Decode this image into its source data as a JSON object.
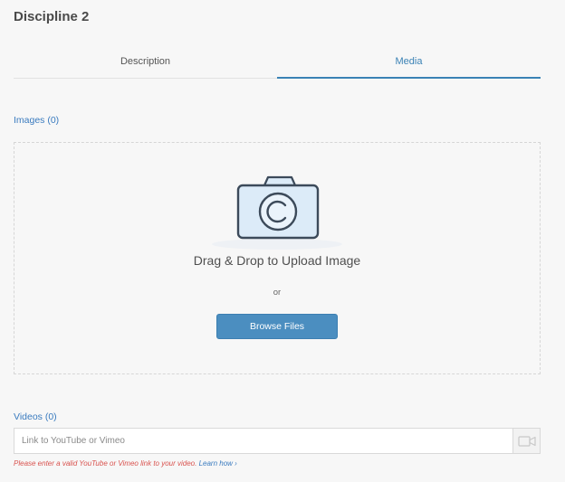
{
  "page": {
    "title": "Discipline 2"
  },
  "tabs": [
    {
      "label": "Description",
      "active": false
    },
    {
      "label": "Media",
      "active": true
    }
  ],
  "images": {
    "label": "Images (0)",
    "icon": "camera-icon",
    "drag_text": "Drag & Drop to Upload Image",
    "or_text": "or",
    "browse_label": "Browse Files"
  },
  "videos": {
    "label": "Videos (0)",
    "placeholder": "Link to YouTube or Vimeo",
    "value": "",
    "icon": "video-camera-icon",
    "error_text": "Please enter a valid YouTube or Vimeo link to your video.",
    "learn_how": "Learn how ›"
  },
  "colors": {
    "accent": "#3a82b5",
    "button": "#4b8ec0",
    "error": "#d9534f"
  }
}
